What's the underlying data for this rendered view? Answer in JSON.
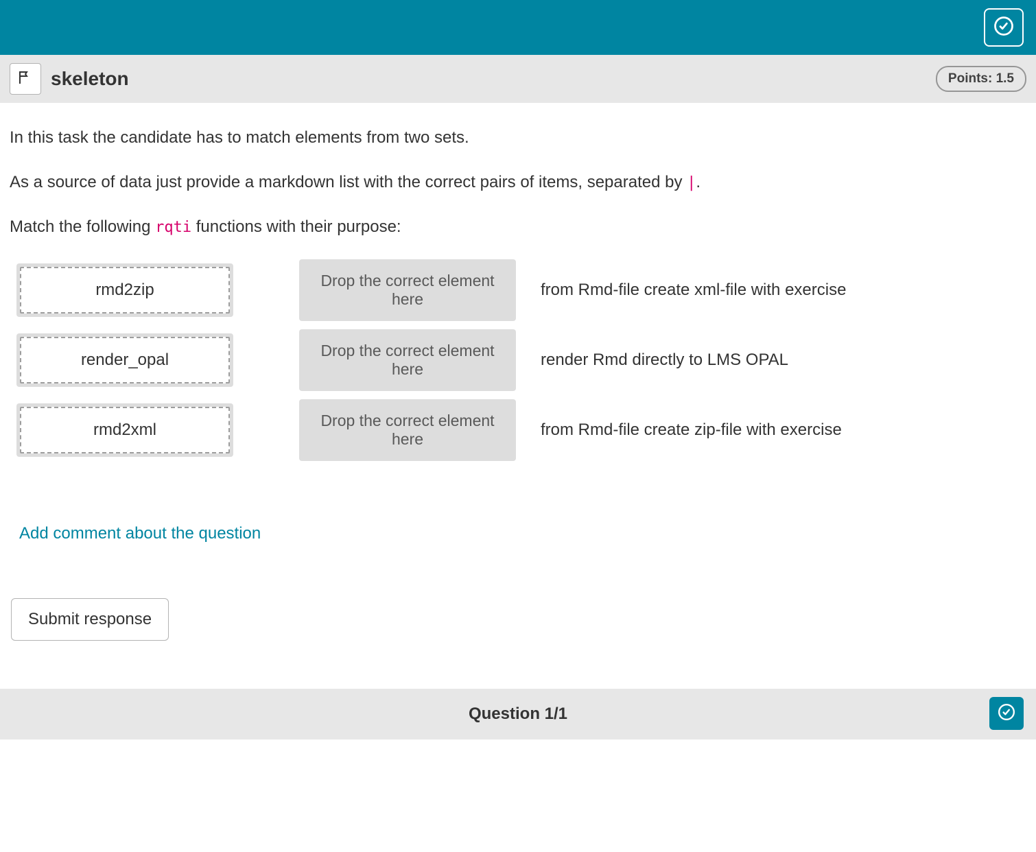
{
  "colors": {
    "accent": "#0085a1",
    "code": "#d6006b"
  },
  "header": {
    "title": "skeleton",
    "points_label": "Points: 1.5"
  },
  "instructions": {
    "p1": "In this task the candidate has to match elements from two sets.",
    "p2_pre": "As a source of data just provide a markdown list with the correct pairs of items, separated by ",
    "p2_code": "|",
    "p2_post": ".",
    "p3_pre": "Match the following ",
    "p3_code": "rqti",
    "p3_post": " functions with their purpose:"
  },
  "drop_placeholder": "Drop the correct element here",
  "matches": [
    {
      "drag": "rmd2zip",
      "purpose": "from Rmd-file create xml-file with exercise"
    },
    {
      "drag": "render_opal",
      "purpose": "render Rmd directly to LMS OPAL"
    },
    {
      "drag": "rmd2xml",
      "purpose": "from Rmd-file create zip-file with exercise"
    }
  ],
  "actions": {
    "add_comment": "Add comment about the question",
    "submit": "Submit response"
  },
  "footer": {
    "counter": "Question 1/1"
  }
}
